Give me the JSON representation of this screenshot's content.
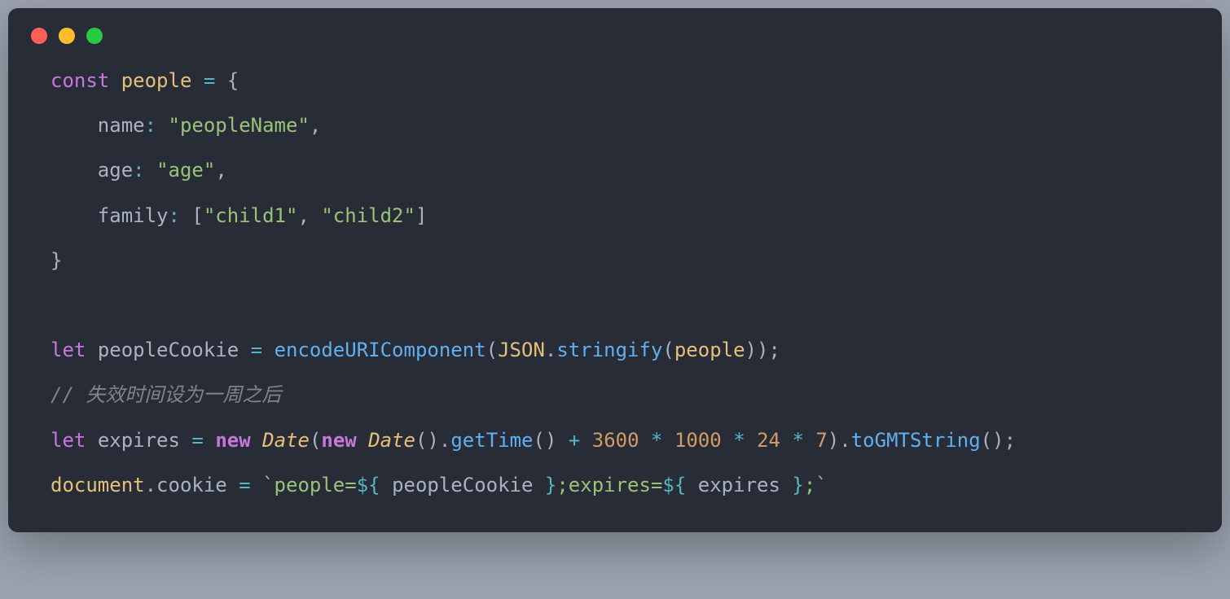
{
  "code": {
    "line1": {
      "const": "const",
      "people": "people",
      "equals": "=",
      "openBrace": "{"
    },
    "line2": {
      "indent": "    ",
      "prop": "name",
      "colon": ":",
      "value": "\"peopleName\"",
      "comma": ","
    },
    "line3": {
      "indent": "    ",
      "prop": "age",
      "colon": ":",
      "value": "\"age\"",
      "comma": ","
    },
    "line4": {
      "indent": "    ",
      "prop": "family",
      "colon": ":",
      "openBracket": "[",
      "value1": "\"child1\"",
      "comma1": ",",
      "value2": "\"child2\"",
      "closeBracket": "]"
    },
    "line5": {
      "closeBrace": "}"
    },
    "line7": {
      "let": "let",
      "var": "peopleCookie",
      "equals": "=",
      "func1": "encodeURIComponent",
      "open1": "(",
      "json": "JSON",
      "dot1": ".",
      "func2": "stringify",
      "open2": "(",
      "arg": "people",
      "close2": ")",
      "close1": ")",
      "semi": ";"
    },
    "line8": {
      "comment": "// 失效时间设为一周之后"
    },
    "line9": {
      "let": "let",
      "var": "expires",
      "equals": "=",
      "new1": "new",
      "date1": "Date",
      "open1": "(",
      "new2": "new",
      "date2": "Date",
      "open2": "(",
      "close2": ")",
      "dot1": ".",
      "getTime": "getTime",
      "open3": "(",
      "close3": ")",
      "plus": "+",
      "n3600": "3600",
      "mul1": "*",
      "n1000": "1000",
      "mul2": "*",
      "n24": "24",
      "mul3": "*",
      "n7": "7",
      "close1": ")",
      "dot2": ".",
      "toGMT": "toGMTString",
      "open4": "(",
      "close4": ")",
      "semi": ";"
    },
    "line10": {
      "doc": "document",
      "dot1": ".",
      "cookie": "cookie",
      "equals": "=",
      "tplOpen": "`people=",
      "interp1Open": "${ ",
      "var1": "peopleCookie",
      "interp1Close": " }",
      "tplMid": ";expires=",
      "interp2Open": "${ ",
      "var2": "expires",
      "interp2Close": " }",
      "tplEnd": ";`"
    }
  }
}
